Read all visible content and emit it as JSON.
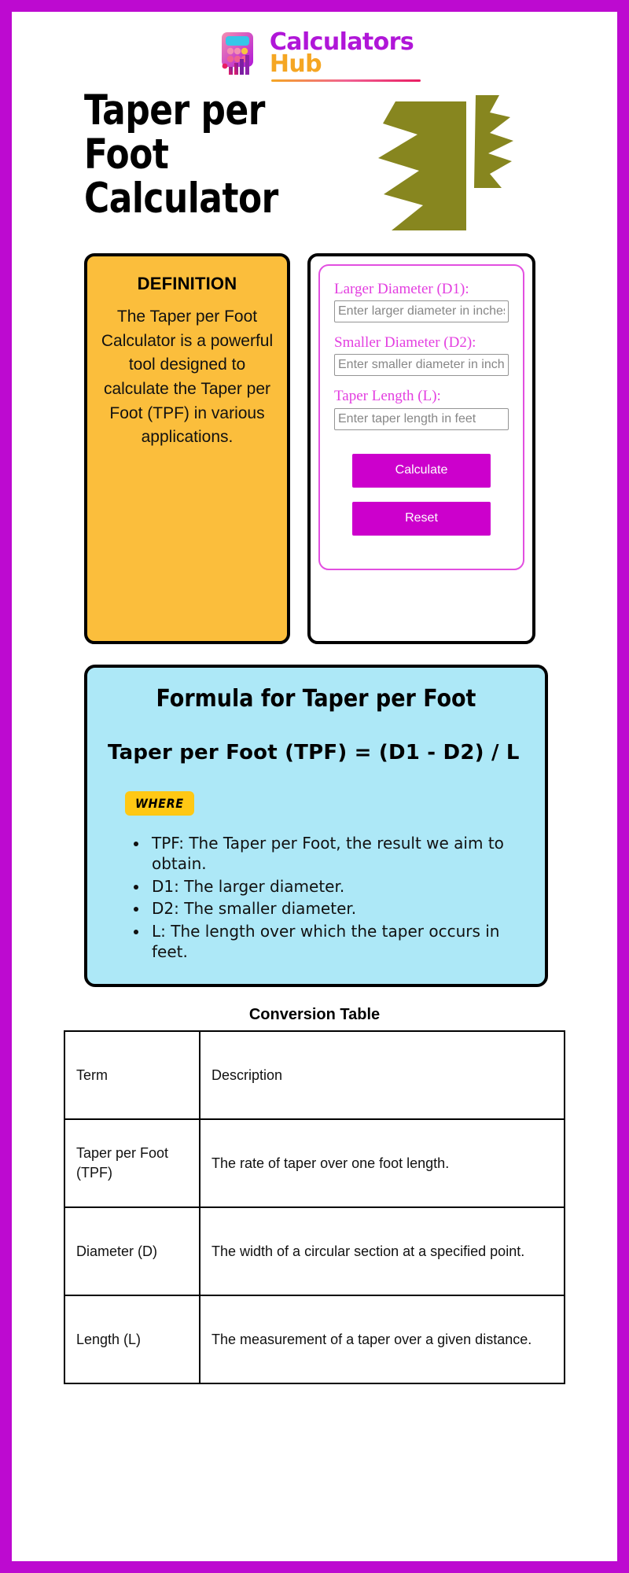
{
  "brand": {
    "name_primary": "Calculators",
    "name_secondary": "Hub",
    "logo_icon": "calculator-bar-chart-icon",
    "color_primary": "#b016d8",
    "color_secondary": "#f5a623"
  },
  "page": {
    "title": "Taper per Foot Calculator",
    "border_color": "#bd0ad0",
    "decoration_color": "#87861f"
  },
  "definition": {
    "heading": "DEFINITION",
    "body": "The Taper per Foot Calculator is a powerful tool designed to calculate the Taper per Foot (TPF) in various applications.",
    "background_color": "#fbbe3c"
  },
  "calculator": {
    "accent_color": "#cc00cc",
    "label_color": "#e33fe0",
    "fields": [
      {
        "label": "Larger Diameter (D1):",
        "placeholder": "Enter larger diameter in inches",
        "value": ""
      },
      {
        "label": "Smaller Diameter (D2):",
        "placeholder": "Enter smaller diameter in inches",
        "value": ""
      },
      {
        "label": "Taper Length (L):",
        "placeholder": "Enter taper length in feet",
        "value": ""
      }
    ],
    "calculate_label": "Calculate",
    "reset_label": "Reset"
  },
  "formula": {
    "heading": "Formula for Taper per Foot",
    "equation": "Taper per Foot (TPF) = (D1 - D2) / L",
    "where_badge": "WHERE",
    "background_color": "#ade8f7",
    "badge_color": "#ffc814",
    "items": [
      "TPF: The Taper per Foot, the result we aim to obtain.",
      "D1: The larger diameter.",
      "D2: The smaller diameter.",
      "L: The length over which the taper occurs in feet."
    ]
  },
  "conversion_table": {
    "title": "Conversion Table",
    "headers": [
      "Term",
      "Description"
    ],
    "rows": [
      [
        "Taper per Foot (TPF)",
        "The rate of taper over one foot length."
      ],
      [
        "Diameter (D)",
        "The width of a circular section at a specified point."
      ],
      [
        "Length (L)",
        "The measurement of a taper over a given distance."
      ]
    ]
  }
}
